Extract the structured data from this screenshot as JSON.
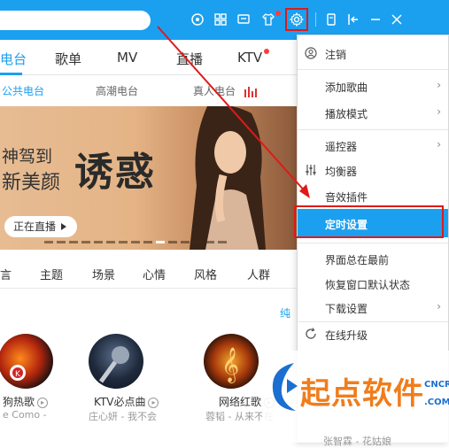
{
  "tabs": [
    {
      "label": "电台",
      "active": true
    },
    {
      "label": "歌单",
      "active": false
    },
    {
      "label": "MV",
      "active": false
    },
    {
      "label": "直播",
      "active": false
    },
    {
      "label": "KTV",
      "active": false
    }
  ],
  "subtabs": [
    {
      "label": "公共电台",
      "active": true
    },
    {
      "label": "高潮电台",
      "active": false
    },
    {
      "label": "真人电台",
      "active": false
    }
  ],
  "banner": {
    "line1": "神驾到",
    "line2": "新美颜",
    "headline": "诱惑",
    "live_label": "正在直播"
  },
  "categories": [
    "言",
    "主题",
    "场景",
    "心情",
    "风格",
    "人群"
  ],
  "pure_link": "纯",
  "cards": [
    {
      "title": "狗热歌",
      "sub": "e Como -"
    },
    {
      "title": "KTV必点曲",
      "sub": "庄心妍 - 我不会"
    },
    {
      "title": "网络红歌",
      "sub": "蓉韬 - 从来不在"
    }
  ],
  "card_tail": "张智霖 - 花姑娘",
  "menu": {
    "items": [
      {
        "label": "注销",
        "icon": "user-icon",
        "arrow": false,
        "selected": false
      },
      {
        "label": "添加歌曲",
        "icon": "",
        "arrow": true,
        "selected": false
      },
      {
        "label": "播放模式",
        "icon": "",
        "arrow": true,
        "selected": false
      },
      {
        "label": "遥控器",
        "icon": "",
        "arrow": true,
        "selected": false
      },
      {
        "label": "均衡器",
        "icon": "equalizer-icon",
        "arrow": false,
        "selected": false
      },
      {
        "label": "音效插件",
        "icon": "",
        "arrow": false,
        "selected": false
      },
      {
        "label": "定时设置",
        "icon": "",
        "arrow": false,
        "selected": true
      },
      {
        "label": "界面总在最前",
        "icon": "",
        "arrow": false,
        "selected": false
      },
      {
        "label": "恢复窗口默认状态",
        "icon": "",
        "arrow": false,
        "selected": false
      },
      {
        "label": "下载设置",
        "icon": "",
        "arrow": true,
        "selected": false
      },
      {
        "label": "在线升级",
        "icon": "refresh-icon",
        "arrow": false,
        "selected": false
      }
    ]
  },
  "watermark": {
    "text": "起点软件",
    "cn": "CNCRK",
    "com": ".COM"
  },
  "colors": {
    "accent": "#1ba0f0",
    "highlight": "#e01919",
    "watermark": "#f07d1b"
  }
}
